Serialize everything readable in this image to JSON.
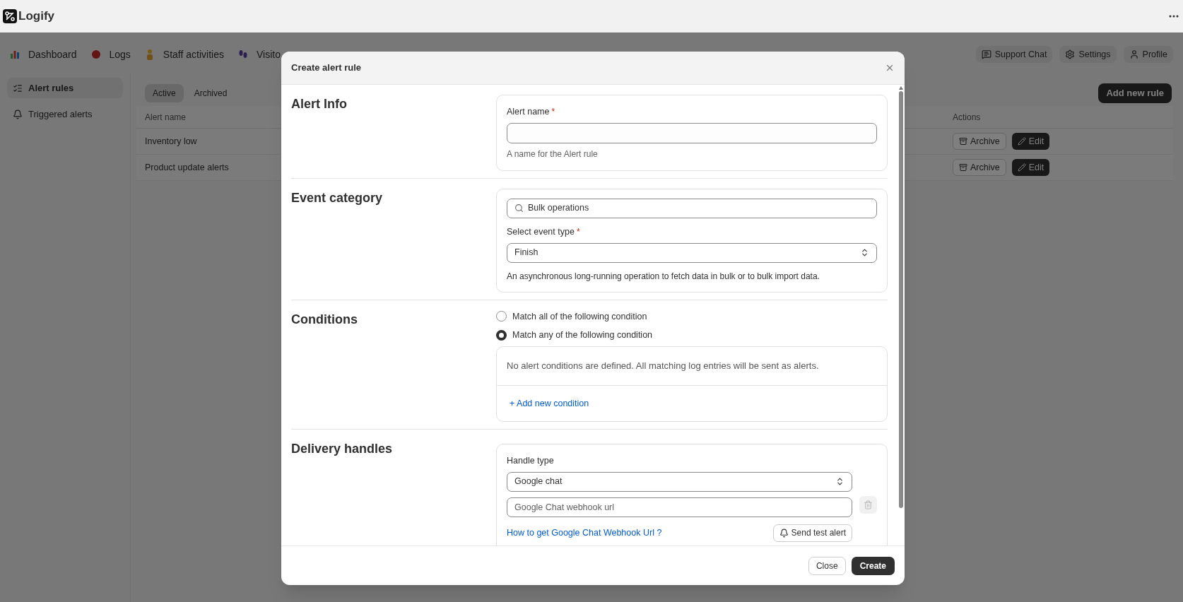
{
  "app": {
    "name": "Logify"
  },
  "nav_tabs": [
    {
      "label": "Dashboard"
    },
    {
      "label": "Logs"
    },
    {
      "label": "Staff activities"
    },
    {
      "label": "Visito"
    }
  ],
  "header_buttons": [
    "Support Chat",
    "Settings",
    "Profile"
  ],
  "sidebar": {
    "items": [
      {
        "label": "Alert rules",
        "selected": true
      },
      {
        "label": "Triggered alerts",
        "selected": false
      }
    ]
  },
  "filter_tabs": [
    {
      "label": "Active",
      "selected": true
    },
    {
      "label": "Archived",
      "selected": false
    }
  ],
  "add_button": "Add new rule",
  "table": {
    "columns": [
      "Alert name",
      "Actions"
    ],
    "rows": [
      {
        "name": "Inventory low",
        "archive": "Archive",
        "edit": "Edit"
      },
      {
        "name": "Product update alerts",
        "archive": "Archive",
        "edit": "Edit"
      }
    ]
  },
  "modal": {
    "title": "Create alert rule",
    "alert_info": {
      "heading": "Alert Info",
      "label": "Alert name",
      "required_mark": "*",
      "help": "A name for the Alert rule"
    },
    "event_category": {
      "heading": "Event category",
      "search_value": "Bulk operations",
      "label": "Select event type",
      "required_mark": "*",
      "value": "Finish",
      "help": "An asynchronous long-running operation to fetch data in bulk or to bulk import data."
    },
    "conditions": {
      "heading": "Conditions",
      "options": [
        {
          "label": "Match all of the following condition",
          "selected": false
        },
        {
          "label": "Match any of the following condition",
          "selected": true
        }
      ],
      "empty_text": "No alert conditions are defined. All matching log entries will be sent as alerts.",
      "add_link": "+ Add new condition"
    },
    "delivery": {
      "heading": "Delivery handles",
      "label": "Handle type",
      "value": "Google chat",
      "url_placeholder": "Google Chat webhook url",
      "help_link": "How to get Google Chat Webhook Url ?",
      "test_button": "Send test alert"
    },
    "buttons": [
      "Close",
      "Create"
    ]
  }
}
